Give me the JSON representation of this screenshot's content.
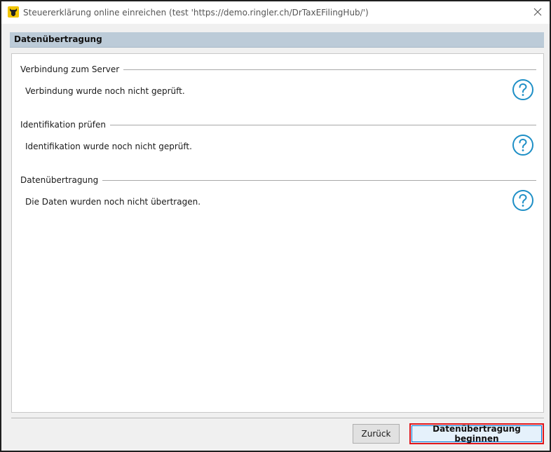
{
  "window": {
    "title": "Steuererklärung online einreichen (test 'https://demo.ringler.ch/DrTaxEFilingHub/')",
    "icon": "bull-logo-icon",
    "close_icon": "close-icon"
  },
  "header": {
    "title": "Datenübertragung"
  },
  "sections": [
    {
      "title": "Verbindung zum Server",
      "status": "Verbindung wurde noch nicht geprüft.",
      "icon": "question-circle-icon"
    },
    {
      "title": "Identifikation prüfen",
      "status": "Identifikation wurde noch nicht geprüft.",
      "icon": "question-circle-icon"
    },
    {
      "title": "Datenübertragung",
      "status": "Die Daten wurden noch nicht übertragen.",
      "icon": "question-circle-icon"
    }
  ],
  "footer": {
    "back_label": "Zurück",
    "start_label": "Datenübertragung beginnen"
  },
  "colors": {
    "header_bar": "#bccbd8",
    "help_icon": "#1e8fc6",
    "highlight_outline": "#e0161b",
    "primary_button_border": "#0078d7"
  }
}
